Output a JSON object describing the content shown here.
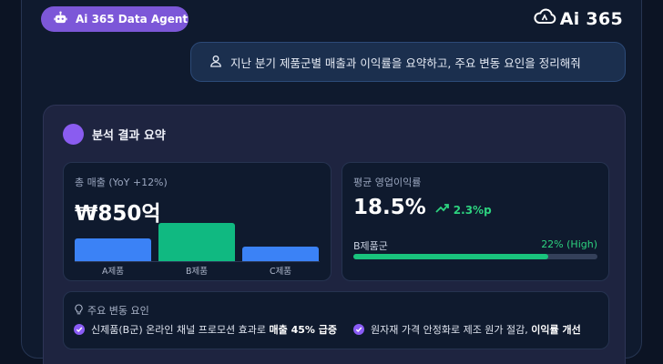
{
  "header": {
    "agent_label": "Ai 365 Data Agent",
    "agent_icon": "robot-icon",
    "brand_name": "Ai 365",
    "brand_icon": "cloud-logo-icon"
  },
  "prompt": {
    "text": "지난 분기 제품군별 매출과 이익률을 요약하고, 주요 변동 요인을 정리해줘",
    "icon": "user-icon"
  },
  "result": {
    "title": "분석 결과 요약",
    "sales": {
      "label": "총 매출 (YoY +12%)",
      "value": "₩850억"
    },
    "margin": {
      "label": "평균 영업이익률",
      "value": "18.5%",
      "change": "2.3%p",
      "bar_label": "B제품군",
      "bar_value": "22% (High)",
      "bar_fill_fraction": 0.8
    },
    "factors": {
      "title": "주요 변동 요인",
      "items": [
        {
          "prefix": "신제품(B군) 온라인 채널 프로모션 효과로 ",
          "highlight": "매출 45% 급증"
        },
        {
          "prefix": "원자재 가격 안정화로 제조 원가 절감, ",
          "highlight": "이익률 개선"
        }
      ]
    }
  },
  "chart_data": {
    "type": "bar",
    "categories": [
      "A제품",
      "B제품",
      "C제품"
    ],
    "values": [
      23,
      39,
      15
    ],
    "colors": [
      "#3b82f6",
      "#10b981",
      "#3b82f6"
    ]
  }
}
